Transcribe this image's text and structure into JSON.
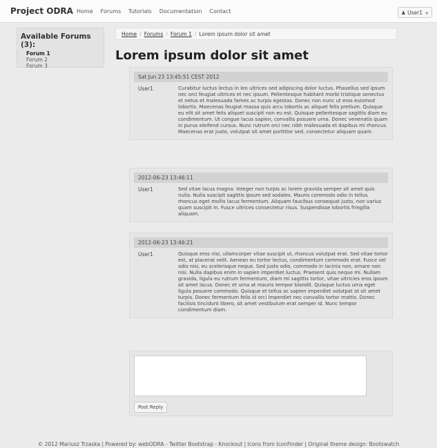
{
  "navbar": {
    "brand": "Project ODRA",
    "links": [
      "Home",
      "Forums",
      "Tutorials",
      "Documentation",
      "Contact"
    ],
    "user_label": "User1"
  },
  "sidebar": {
    "title": "Available Forums (3):",
    "items": [
      "Forum 1",
      "Forum 2",
      "Forum 3"
    ],
    "active_item": "Forum 1"
  },
  "breadcrumb": {
    "items": [
      "Home",
      "Forums",
      "Forum 1"
    ],
    "current": "Lorem ipsum dolor sit amet"
  },
  "page_title": "Lorem ipsum dolor sit amet",
  "posts": [
    {
      "timestamp": "Sat Jun 23 13:45:51 CEST 2012",
      "author": "User1",
      "text": "Curabitur luctus lectus in leo ultrices sed adipiscing dolor luctus. Phasellus sed ipsum nec orci feugiat ultrices et nec ipsum. Pellentesque habitant morbi tristique senectus et netus et malesuada fames ac turpis egestas. Donec non nunc ut eros euismod lobortis. Maecenas feugiat massa quis arcu lobortis ac aliquet felis pretium. Quisque eu elit sit amet felis aliquet suscipit non eu est. Quisque pellentesque sagittis diam eu condimentum. Ut congue lacus sapien, convallis posuere urna. Donec venenatis quam in purus eleifend cursus. Nunc rutrum orci nec nibh malesuada et dapibus mi rhoncus. Maecenas erat justo, volutpat sit amet porttitor sed, consectetur aliquam quam."
    },
    {
      "timestamp": "2012-06-23 13:46:11",
      "author": "User1",
      "text": "Sed vitae lacus magna. Integer non turpis ac lorem gravida semper sit amet quis nulla. Nulla suscipit sagittis ipsum sed sodales. Mauris commodo odio in tellus rhoncus eget mollis lacus fermentum. Aliquam faucibus consequat justo, non varius quam suscipit in. Fusce ultrices consectetur risus. Suspendisse lobortis fringilla aliquam."
    },
    {
      "timestamp": "2012-06-23 13:46:21",
      "author": "User1",
      "text": "Quisque eros nisi, ullamcorper vitae suscipit ut, rhoncus volutpat erat. Sed vitae tortor est, at placerat velit. Aenean eu tortor lectus, condimentum commodo erat. Fusce vel odio nisi, eu scelerisque neque. Sed justo odio, commodo in lacinia non, ornare non nisi. Nulla dapibus enim in sapien imperdiet luctus. Praesent quis neque mi. Nullam gravida, ligula eu rutrum fermentum, diam mi sagittis tortor, vitae ultricies eros ipsum sit amet lacus. Donec et urna at mauris tempor blandit. Quisque luctus urna eget ligula posuere commodo. Quisque et tellus ac sapien imperdiet volutpat at sit amet turpis. Donec fermentum felis id orci imperdiet nec convallis tortor mattis. Donec facilisis tincidunt libero, sit amet vestibulum erat semper id. Nunc tempor condimentum diam."
    }
  ],
  "reply": {
    "textarea_value": "",
    "button_label": "Post Reply"
  },
  "footer": {
    "text": "© 2012 Mariusz Trzaska | Powered by: webODRA - Twitter Bootstrap - Knockout | Icons from IconFinder | Original theme design: Bootswatch"
  },
  "colors": {
    "background": "#ebebeb",
    "navbar": "#fbfbfb",
    "panel": "#e6e6e6",
    "post_header": "#d2d2d2"
  }
}
